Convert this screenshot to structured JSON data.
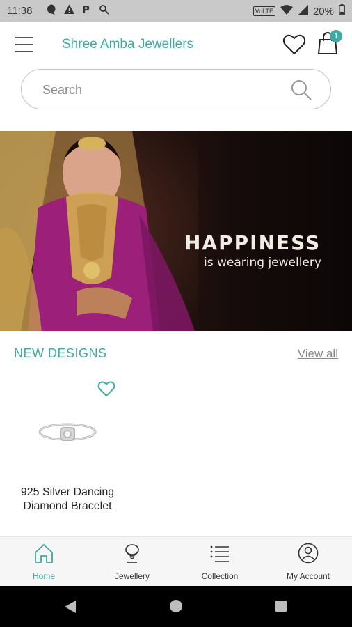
{
  "status_bar": {
    "time": "11:38",
    "network_label": "VoLTE",
    "battery": "20%"
  },
  "header": {
    "title": "Shree Amba Jewellers",
    "cart_count": "1"
  },
  "search": {
    "placeholder": "Search"
  },
  "banner": {
    "headline": "HAPPINESS",
    "subline": "is wearing jewellery"
  },
  "new_designs": {
    "title": "NEW DESIGNS",
    "view_all": "View all",
    "products": [
      {
        "name": "925 Silver Dancing Diamond Bracelet"
      }
    ]
  },
  "bottom_nav": {
    "items": [
      {
        "label": "Home",
        "icon": "home-icon",
        "active": true
      },
      {
        "label": "Jewellery",
        "icon": "necklace-icon",
        "active": false
      },
      {
        "label": "Collection",
        "icon": "list-icon",
        "active": false
      },
      {
        "label": "My Account",
        "icon": "account-icon",
        "active": false
      }
    ]
  },
  "colors": {
    "accent": "#3eaaa4",
    "status_bar": "#c9c9c9",
    "nav_background": "#f6f6f6"
  }
}
